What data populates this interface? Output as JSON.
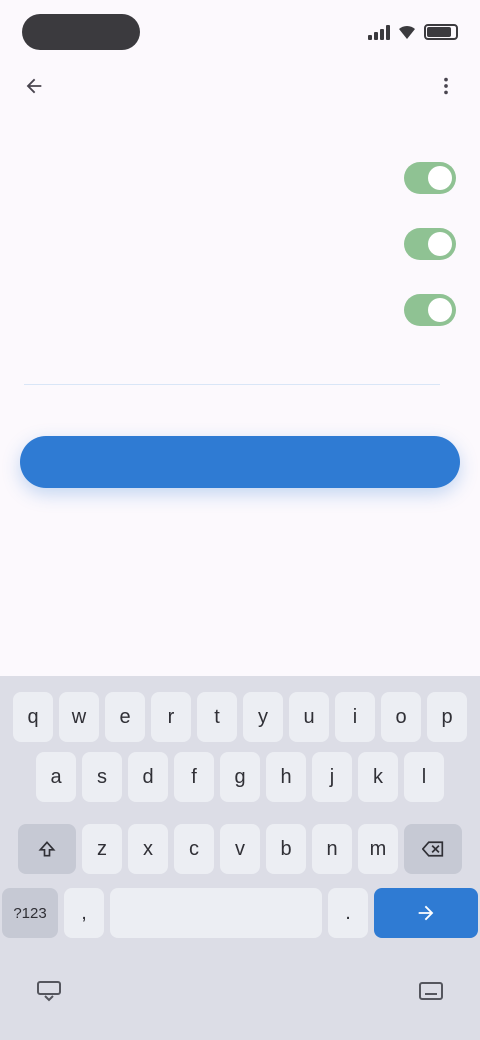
{
  "status_bar": {
    "time": "",
    "icons": [
      "signal-icon",
      "wifi-icon",
      "battery-icon"
    ],
    "battery_level": 0.85
  },
  "app_bar": {
    "title": "",
    "back_icon": "arrow-back-icon",
    "more_icon": "more-vert-icon"
  },
  "settings": {
    "section_header": "",
    "rows": [
      {
        "title": "",
        "subtitle": "",
        "enabled": true
      },
      {
        "title": "",
        "subtitle": "",
        "enabled": true
      },
      {
        "title": "",
        "subtitle": "",
        "enabled": true
      }
    ]
  },
  "primary_button": {
    "label": ""
  },
  "keyboard": {
    "row1": [
      "q",
      "w",
      "e",
      "r",
      "t",
      "y",
      "u",
      "i",
      "o",
      "p"
    ],
    "row2": [
      "a",
      "s",
      "d",
      "f",
      "g",
      "h",
      "j",
      "k",
      "l"
    ],
    "row3": [
      "z",
      "x",
      "c",
      "v",
      "b",
      "n",
      "m"
    ],
    "shift_icon": "shift-icon",
    "backspace_icon": "backspace-icon",
    "symbols_label": "?123",
    "comma_label": ",",
    "space_label": "",
    "period_label": ".",
    "action_icon": "arrow-forward-icon",
    "nav_left_icon": "keyboard-down-icon",
    "nav_right_icon": "keyboard-icon"
  },
  "colors": {
    "accent": "#2f7bd3",
    "switch_on": "#8fc293",
    "background": "#fcf9fd",
    "keyboard_bg": "#dcdde6"
  }
}
